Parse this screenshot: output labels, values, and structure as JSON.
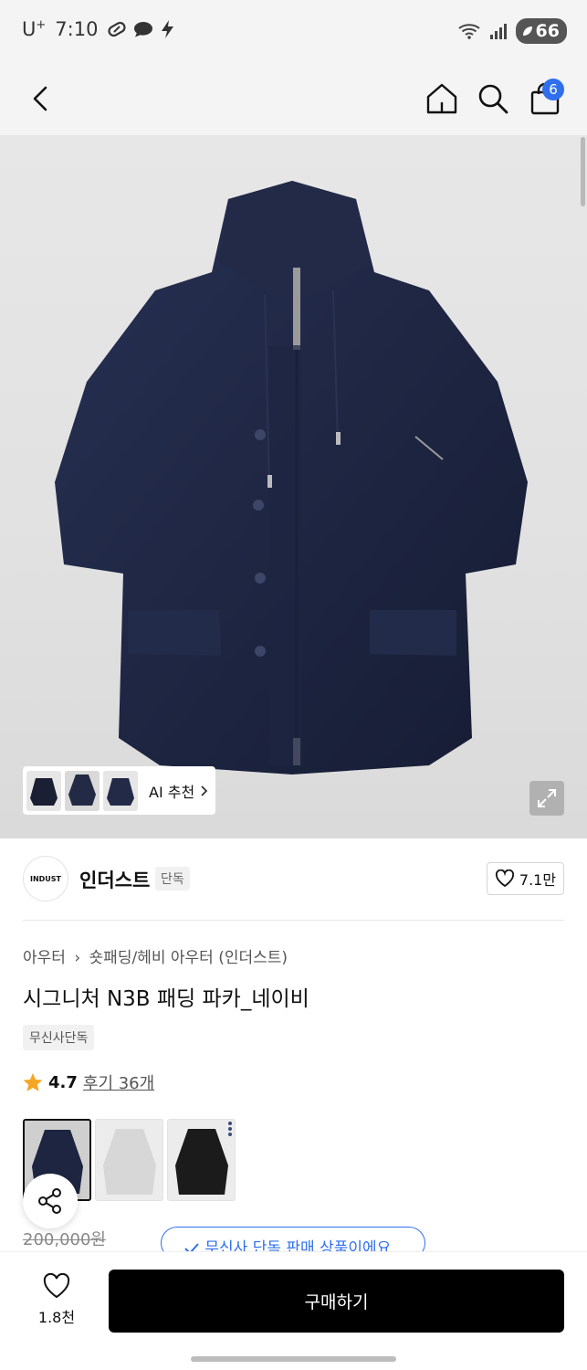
{
  "status": {
    "carrier": "U",
    "carrier_sup": "+",
    "time": "7:10",
    "battery": "66"
  },
  "nav": {
    "cart_count": "6"
  },
  "hero": {
    "ai_label": "AI 추천"
  },
  "brand": {
    "logo_text": "INDUST",
    "name": "인더스트",
    "exclusive": "단독",
    "likes": "7.1만"
  },
  "product": {
    "breadcrumb_parent": "아우터",
    "breadcrumb_child": "숏패딩/헤비 아우터 (인더스트)",
    "title": "시그니처 N3B 패딩 파카_네이비",
    "tag": "무신사단독",
    "rating": "4.7",
    "reviews": "후기 36개",
    "original_price": "200,000원",
    "exclusive_notice": "무신사 단독 판매 상품이에요"
  },
  "colors": [
    {
      "name": "navy",
      "hex": "#1d2540"
    },
    {
      "name": "light-gray",
      "hex": "#d7d7d7"
    },
    {
      "name": "black",
      "hex": "#1b1b1b"
    }
  ],
  "bottom": {
    "wish_count": "1.8천",
    "buy_label": "구매하기"
  }
}
